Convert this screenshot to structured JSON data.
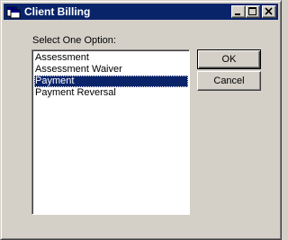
{
  "window": {
    "title": "Client Billing",
    "icon": "app-window-icon"
  },
  "titlebar_buttons": {
    "minimize": "minimize-icon",
    "maximize": "maximize-icon",
    "close": "close-icon"
  },
  "dialog": {
    "prompt": "Select One Option:",
    "options": [
      {
        "label": "Assessment",
        "selected": false
      },
      {
        "label": "Assessment Waiver",
        "selected": false
      },
      {
        "label": "Payment",
        "selected": true
      },
      {
        "label": "Payment Reversal",
        "selected": false
      }
    ],
    "ok_label": "OK",
    "cancel_label": "Cancel"
  },
  "colors": {
    "titlebar": "#0a246a",
    "selection": "#0a246a",
    "face": "#d4d0c8"
  }
}
